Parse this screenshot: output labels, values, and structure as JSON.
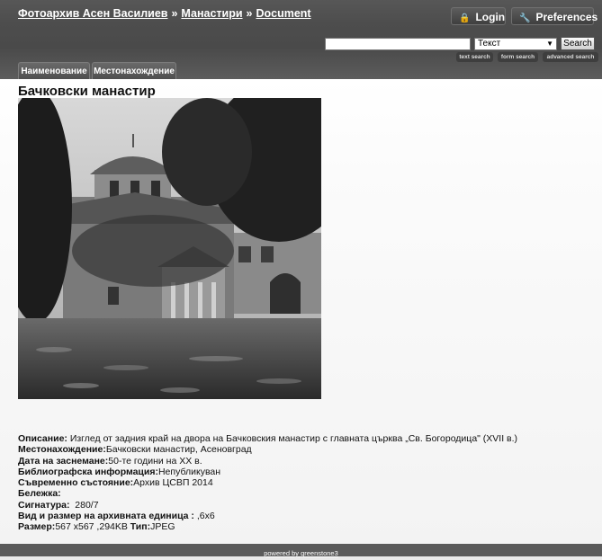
{
  "breadcrumb": {
    "site": "Фотоархив Асен Василиев",
    "separator": "»",
    "collection": "Манастири",
    "page": "Document"
  },
  "header": {
    "login_label": "Login",
    "preferences_label": "Preferences"
  },
  "search": {
    "query": "",
    "field_selected": "Текст",
    "button_label": "Search",
    "links": [
      "text search",
      "form search",
      "advanced search"
    ]
  },
  "tabs": [
    "Наименование",
    "Местонахождение"
  ],
  "document": {
    "title": "Бачковски манастир",
    "metadata": [
      {
        "label": "Описание:",
        "value": " Изглед от задния край на двора на Бачковския манастир с главната църква „Св. Богородица\" (XVII в.)"
      },
      {
        "label": "Местонахождение:",
        "value": "Бачковски манастир, Асеновград"
      },
      {
        "label": "Дата на заснемане:",
        "value": "50-те години на XX в."
      },
      {
        "label": "Библиографска информация:",
        "value": "Непубликуван"
      },
      {
        "label": "Съвременно състояние:",
        "value": "Архив ЦСВП 2014"
      },
      {
        "label": "Бележка:",
        "value": ""
      },
      {
        "label": "Сигнатура:",
        "value": "  280/7"
      },
      {
        "label": "Вид и размер на архивната единица :",
        "value": " ,6x6"
      }
    ],
    "size_label": "Размер:",
    "size_value": "567 x567 ,294KB ",
    "type_label": "Тип:",
    "type_value": "JPEG"
  },
  "footer": {
    "powered_by": "powered by greenstone3"
  },
  "icons": {
    "login": "lock-icon",
    "preferences": "wrench-icon",
    "select": "dropdown-arrow-icon"
  }
}
